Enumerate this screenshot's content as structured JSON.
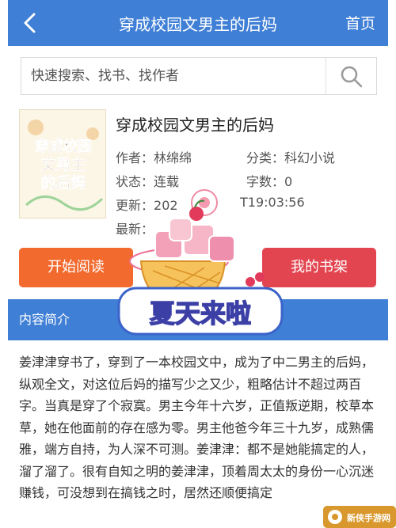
{
  "header": {
    "title": "穿成校园文男主的后妈",
    "home_label": "首页"
  },
  "search": {
    "placeholder": "快速搜索、找书、找作者"
  },
  "book": {
    "title": "穿成校园文男主的后妈",
    "author_label": "作者：",
    "author": "林绵绵",
    "category_label": "分类：",
    "category": "科幻小说",
    "status_label": "状态：",
    "status": "连载",
    "words_label": "字数：",
    "words": "0",
    "updated_label": "更新：",
    "updated_left": "202",
    "updated_right": "T19:03:56",
    "latest_label": "最新：",
    "cover_text": [
      "穿成校园",
      "文男主",
      "的后妈"
    ]
  },
  "buttons": {
    "start_reading": "开始阅读",
    "bookshelf": "我的书架"
  },
  "intro": {
    "heading": "内容简介",
    "text": "姜津津穿书了，穿到了一本校园文中，成为了中二男主的后妈，纵观全文，对这位后妈的描写少之又少，粗略估计不超过两百字。当真是穿了个寂寞。男主今年十六岁，正值叛逆期，校草本草，她在他面前的存在感为零。男主他爸今年三十九岁，成熟儒雅，端方自持，为人深不可测。姜津津：都不是她能搞定的人，溜了溜了。很有自知之明的姜津津，顶着周太太的身份一心沉迷赚钱，可没想到在搞钱之时，居然还顺便搞定"
  },
  "sticker": {
    "text": "夏天来啦"
  },
  "watermark": {
    "text": "新侠手游网"
  },
  "colors": {
    "header": "#3f7fd6",
    "read_button": "#f26a2e",
    "shelf_button": "#e24550"
  }
}
